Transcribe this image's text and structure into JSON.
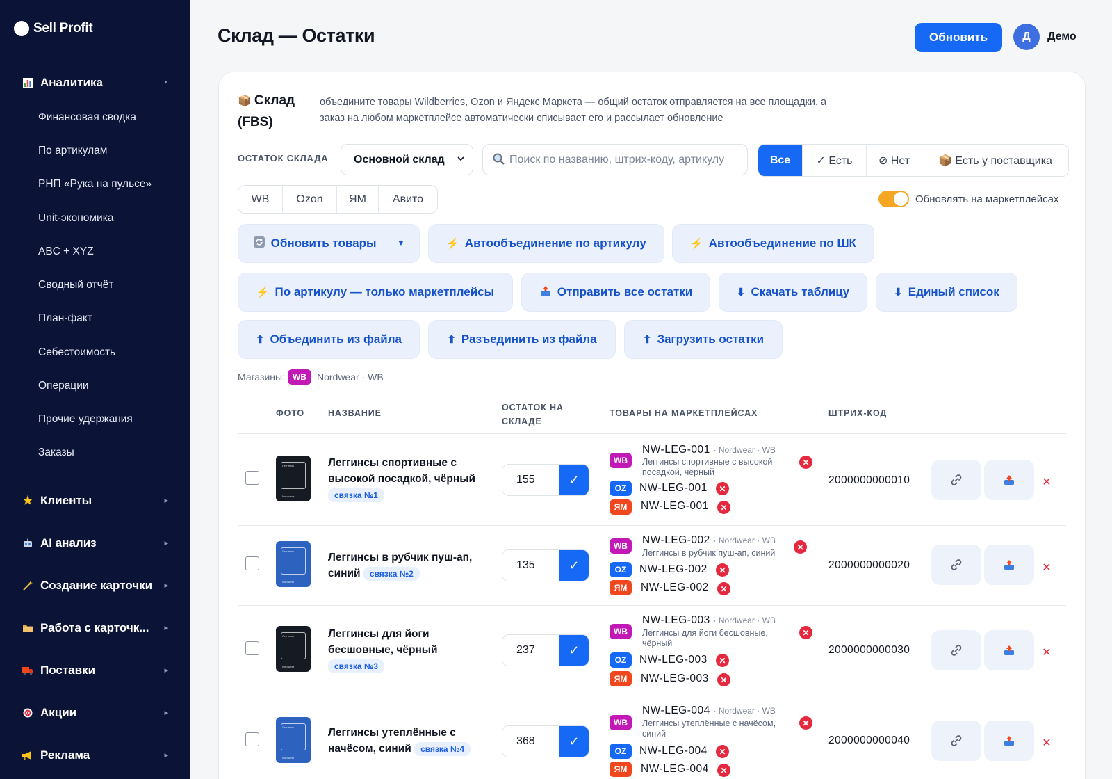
{
  "brand": {
    "name": "Sell Profit"
  },
  "sidebar": {
    "analytics": {
      "label": "Аналитика",
      "icon": "bar-chart-icon"
    },
    "sub_items": [
      "Финансовая сводка",
      "По артикулам",
      "РНП «Рука на пульсе»",
      "Unit-экономика",
      "ABC + XYZ",
      "Сводный отчёт",
      "План-факт",
      "Себестоимость",
      "Операции",
      "Прочие удержания",
      "Заказы"
    ],
    "sections": [
      {
        "label": "Клиенты",
        "icon": "star-icon"
      },
      {
        "label": "AI анализ",
        "icon": "robot-icon"
      },
      {
        "label": "Создание карточки",
        "icon": "magic-wand-icon"
      },
      {
        "label": "Работа с карточк...",
        "icon": "folder-icon"
      },
      {
        "label": "Поставки",
        "icon": "truck-icon"
      },
      {
        "label": "Акции",
        "icon": "target-icon"
      },
      {
        "label": "Реклама",
        "icon": "megaphone-icon"
      }
    ]
  },
  "header": {
    "title": "Склад — Остатки",
    "refresh_label": "Обновить",
    "avatar_letter": "Д",
    "user_name": "Демо"
  },
  "warehouse": {
    "title": "Склад (FBS)",
    "description": "объедините товары Wildberries, Ozon и Яндекс Маркета — общий остаток отправляется на все площадки, а заказ на любом маркетплейсе автоматически списывает его и рассылает обновление"
  },
  "filters": {
    "stock_label": "ОСТАТОК СКЛАДА",
    "warehouse_selected": "Основной склад",
    "search_placeholder": "Поиск по названию, штрих-коду, артикулу",
    "availability": [
      "Все",
      "✓ Есть",
      "⊘ Нет",
      "📦 Есть у поставщика"
    ],
    "availability_active": "Все",
    "marketplaces": [
      "WB",
      "Ozon",
      "ЯМ",
      "Авито"
    ],
    "update_toggle_label": "Обновлять на маркетплейсах",
    "update_toggle_on": true
  },
  "actions": [
    "Обновить товары",
    "Автообъединение по артикулу",
    "Автообъединение по ШК",
    "По артикулу — только маркетплейсы",
    "Отправить все остатки",
    "Скачать таблицу",
    "Единый список",
    "Объединить из файла",
    "Разъединить из файла",
    "Загрузить остатки"
  ],
  "shops": {
    "label": "Магазины:",
    "pill": "WB",
    "name": "Nordwear · WB"
  },
  "table": {
    "headers": {
      "photo": "ФОТО",
      "name": "НАЗВАНИЕ",
      "stock": "ОСТАТОК НА СКЛАДЕ",
      "mp": "ТОВАРЫ НА МАРКЕТПЛЕЙСАХ",
      "barcode": "ШТРИХ-КОД"
    },
    "rows": [
      {
        "name": "Леггинсы спортивные с высокой посадкой, чёрный",
        "link": "связка №1",
        "qty": "155",
        "sku": "NW-LEG-001",
        "meta": "· Nordwear · WB",
        "desc": "Леггинсы спортивные с высокой посадкой, чёрный",
        "barcode": "2000000000010",
        "photo": "dark"
      },
      {
        "name": "Леггинсы в рубчик пуш-ап, синий",
        "link": "связка №2",
        "qty": "135",
        "sku": "NW-LEG-002",
        "meta": "· Nordwear · WB",
        "desc": "Леггинсы в рубчик пуш-ап, синий",
        "barcode": "2000000000020",
        "photo": "blue"
      },
      {
        "name": "Леггинсы для йоги бесшовные, чёрный",
        "link": "связка №3",
        "qty": "237",
        "sku": "NW-LEG-003",
        "meta": "· Nordwear · WB",
        "desc": "Леггинсы для йоги бесшовные, чёрный",
        "barcode": "2000000000030",
        "photo": "dark"
      },
      {
        "name": "Леггинсы утеплённые с начёсом, синий",
        "link": "связка №4",
        "qty": "368",
        "sku": "NW-LEG-004",
        "meta": "· Nordwear · WB",
        "desc": "Леггинсы утеплённые с начёсом, синий",
        "barcode": "2000000000040",
        "photo": "blue"
      }
    ],
    "mp_labels": {
      "wb": "WB",
      "oz": "OZ",
      "ym": "ЯМ"
    },
    "photo_text": {
      "title": "Леггинсы",
      "brand": "Nordwear"
    }
  },
  "colors": {
    "accent": "#1569f5",
    "sidebar_bg": "#0b1437",
    "wb": "#c118b6",
    "ozon": "#1569f5",
    "ym": "#f0471f",
    "toggle": "#f5a623",
    "danger": "#e5283d"
  }
}
